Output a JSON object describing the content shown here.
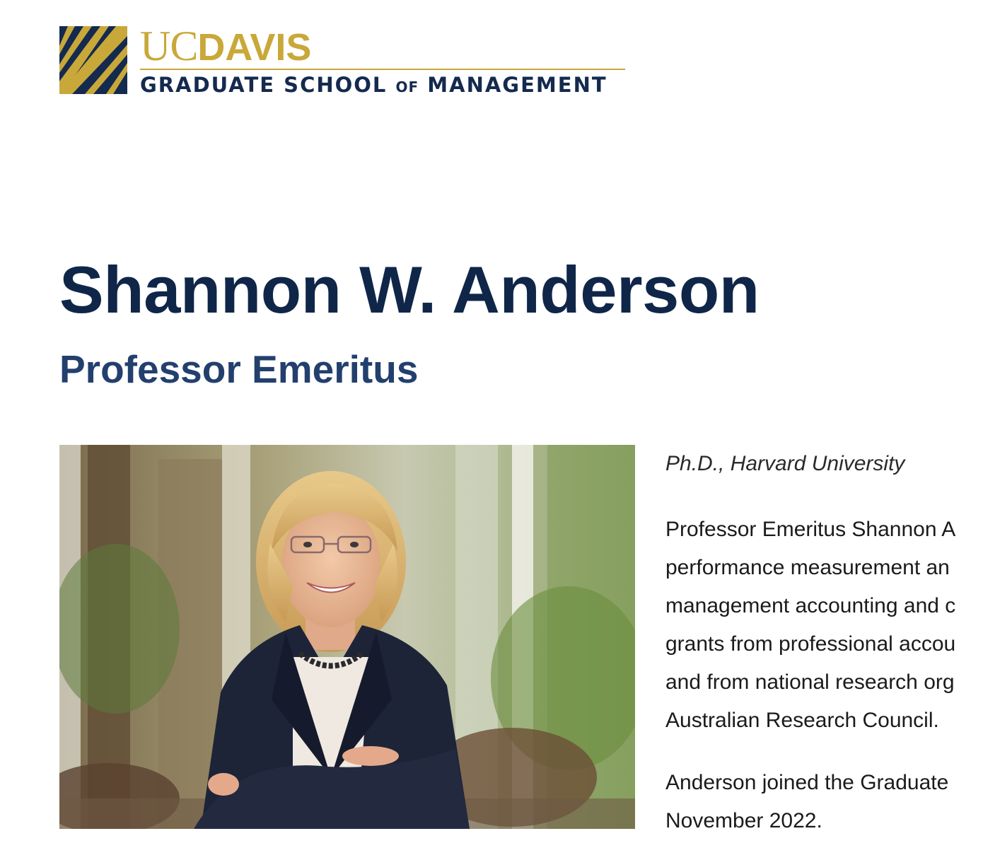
{
  "logo": {
    "uc": "UC",
    "davis": "DAVIS",
    "subtitle_part1": "GRADUATE SCHOOL ",
    "subtitle_of": "OF",
    "subtitle_part2": " MANAGEMENT",
    "colors": {
      "gold": "#c9a83a",
      "navy": "#142a4f"
    }
  },
  "profile": {
    "name": "Shannon W. Anderson",
    "title": "Professor Emeritus",
    "photo_description_icon": "portrait-photo",
    "degree": "Ph.D., Harvard University",
    "bio_paragraph_1": [
      "Professor Emeritus Shannon A",
      "performance measurement an",
      "management accounting and c",
      "grants from professional accou",
      "and from national research org",
      "Australian Research Council."
    ],
    "bio_paragraph_2": [
      "Anderson joined the Graduate",
      "November 2022."
    ]
  },
  "colors": {
    "name": "#0f2649",
    "title": "#233f6e"
  }
}
